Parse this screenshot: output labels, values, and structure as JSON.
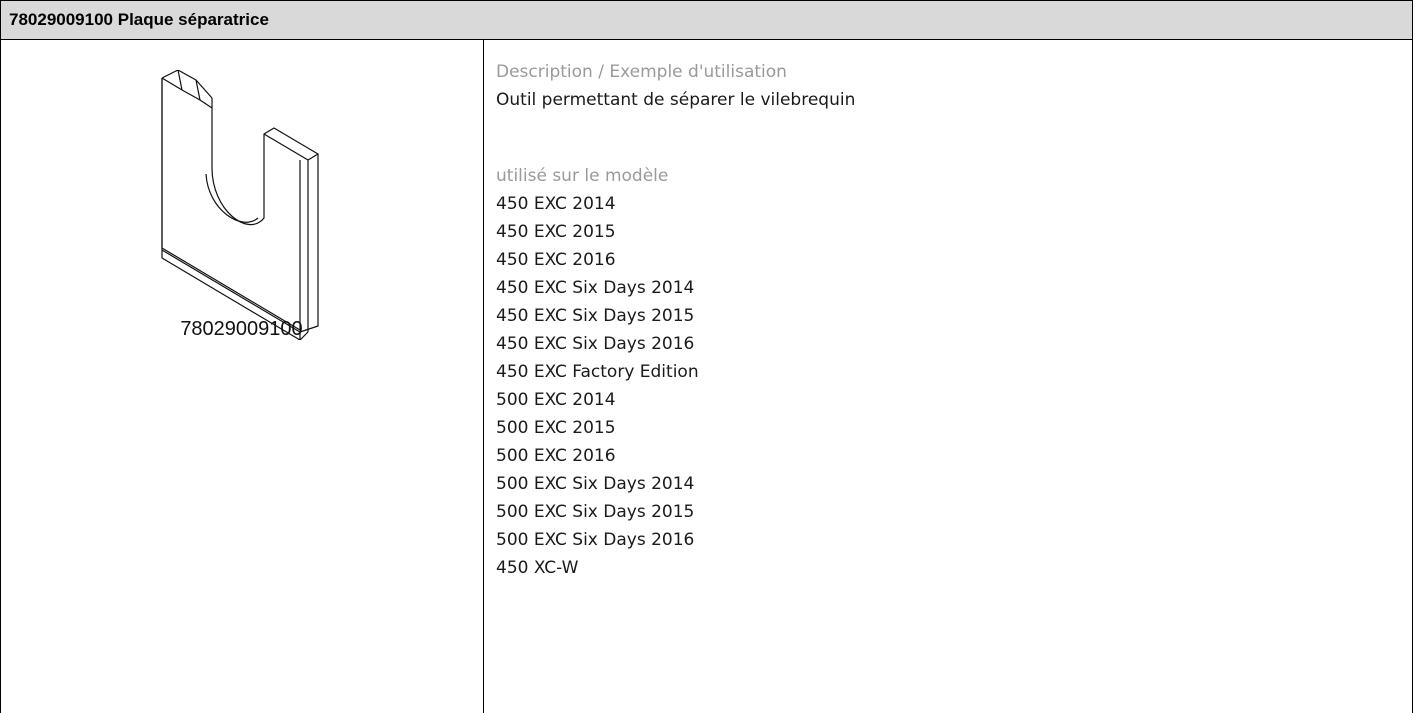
{
  "header": {
    "title": "78029009100 Plaque séparatrice"
  },
  "illustration": {
    "part_number": "78029009100",
    "icon": "separator-plate-drawing"
  },
  "details": {
    "description_label": "Description / Exemple d'utilisation",
    "description_text": "Outil permettant de séparer le vilebrequin",
    "models_label": "utilisé sur le modèle",
    "models": [
      "450 EXC 2014",
      "450 EXC 2015",
      "450 EXC 2016",
      "450 EXC Six Days 2014",
      "450 EXC Six Days 2015",
      "450 EXC Six Days 2016",
      "450 EXC Factory Edition",
      "500 EXC 2014",
      "500 EXC 2015",
      "500 EXC 2016",
      "500 EXC Six Days 2014",
      "500 EXC Six Days 2015",
      "500 EXC Six Days 2016",
      "450 XC-W"
    ]
  }
}
